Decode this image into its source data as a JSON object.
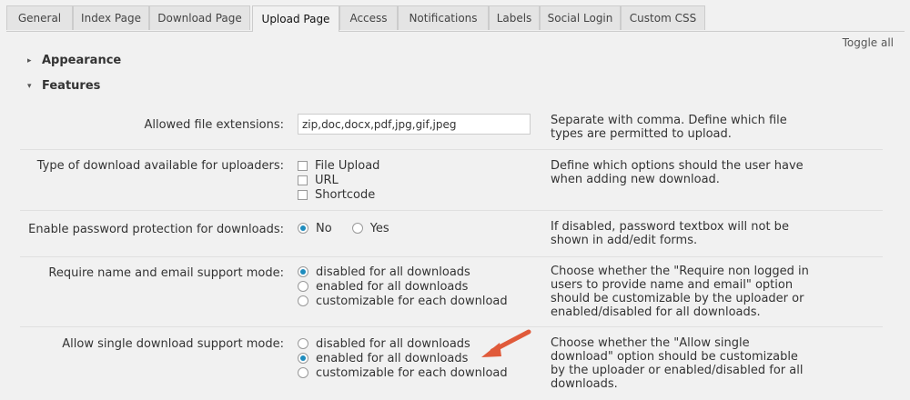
{
  "tabs": [
    {
      "label": "General"
    },
    {
      "label": "Index Page"
    },
    {
      "label": "Download Page"
    },
    {
      "label": "Upload Page",
      "active": true
    },
    {
      "label": "Access"
    },
    {
      "label": "Notifications"
    },
    {
      "label": "Labels"
    },
    {
      "label": "Social Login"
    },
    {
      "label": "Custom CSS"
    }
  ],
  "toggle_all": "Toggle all",
  "sections": {
    "appearance": {
      "label": "Appearance",
      "expanded": false
    },
    "features": {
      "label": "Features",
      "expanded": true
    }
  },
  "fields": {
    "extensions": {
      "label": "Allowed file extensions:",
      "value": "zip,doc,docx,pdf,jpg,gif,jpeg",
      "desc": "Separate with comma. Define which file types are permitted to upload."
    },
    "download_type": {
      "label": "Type of download available for uploaders:",
      "options": [
        {
          "label": "File Upload",
          "checked": false
        },
        {
          "label": "URL",
          "checked": false
        },
        {
          "label": "Shortcode",
          "checked": false
        }
      ],
      "desc": "Define which options should the user have when adding new download."
    },
    "password": {
      "label": "Enable password protection for downloads:",
      "options": [
        {
          "label": "No",
          "selected": true
        },
        {
          "label": "Yes",
          "selected": false
        }
      ],
      "desc": "If disabled, password textbox will not be shown in add/edit forms."
    },
    "require_name": {
      "label": "Require name and email support mode:",
      "options": [
        {
          "label": "disabled for all downloads",
          "selected": true
        },
        {
          "label": "enabled for all downloads",
          "selected": false
        },
        {
          "label": "customizable for each download",
          "selected": false
        }
      ],
      "desc": "Choose whether the \"Require non logged in users to provide name and email\" option should be customizable by the uploader or enabled/disabled for all downloads."
    },
    "single_download": {
      "label": "Allow single download support mode:",
      "options": [
        {
          "label": "disabled for all downloads",
          "selected": false
        },
        {
          "label": "enabled for all downloads",
          "selected": true
        },
        {
          "label": "customizable for each download",
          "selected": false
        }
      ],
      "desc": "Choose whether the \"Allow single download\" option should be customizable by the uploader or enabled/disabled for all downloads."
    }
  },
  "colors": {
    "accent": "#1e8cbe",
    "annotation_arrow": "#e05a3a"
  }
}
